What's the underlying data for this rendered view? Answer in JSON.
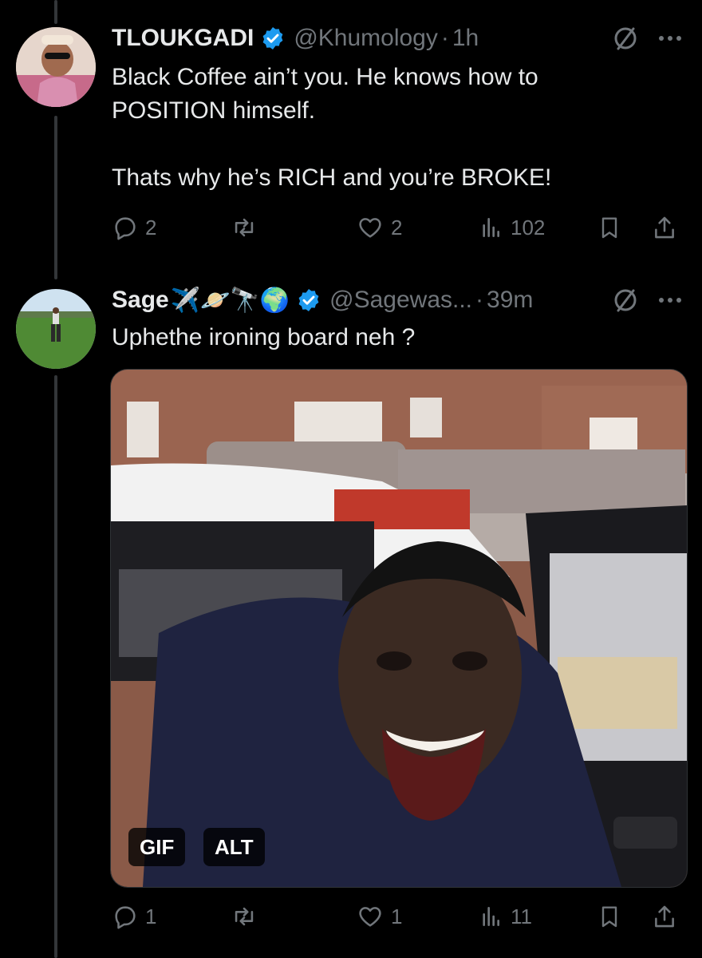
{
  "colors": {
    "background": "#000000",
    "text": "#e7e9ea",
    "muted": "#71767b",
    "verified": "#1d9bf0"
  },
  "tweets": [
    {
      "name": "TLOUKGADI",
      "handle": "@Khumology",
      "time": "1h",
      "text": "Black Coffee ain’t you. He knows how to\nPOSITION himself.\n\nThats why he’s RICH and you’re BROKE!",
      "replies": "2",
      "likes": "2",
      "views": "102"
    },
    {
      "name": "Sage",
      "name_emojis": "✈️🪐🔭🌍",
      "handle": "@Sagewas...",
      "time": "39m",
      "text": "Uphethe ironing board neh ?",
      "media": {
        "gif_label": "GIF",
        "alt_label": "ALT"
      },
      "replies": "1",
      "likes": "1",
      "views": "11"
    }
  ],
  "separator": "·"
}
